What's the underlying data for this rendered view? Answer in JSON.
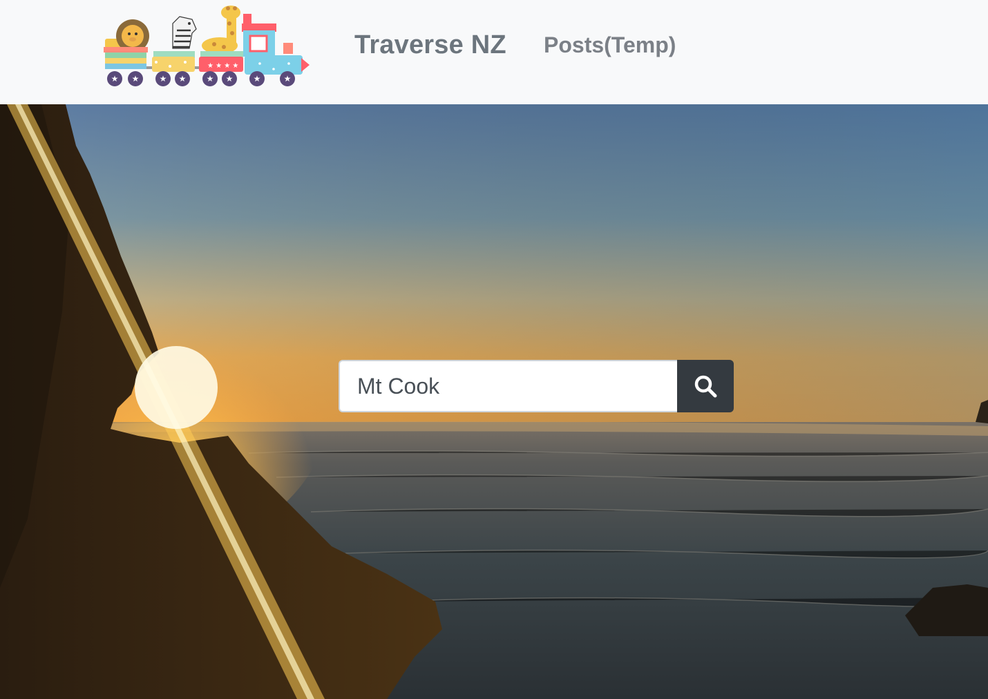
{
  "navbar": {
    "brand": "Traverse NZ",
    "links": [
      {
        "label": "Posts(Temp)"
      }
    ],
    "logo_icon": "animal-train-logo"
  },
  "search": {
    "value": "Mt Cook",
    "button_icon": "search-icon"
  },
  "hero": {
    "background": "sunset-over-ocean-photo"
  },
  "colors": {
    "navbar_bg": "#f8f9fa",
    "brand_text": "#6c757d",
    "search_button": "#343a40",
    "input_text": "#495057"
  }
}
